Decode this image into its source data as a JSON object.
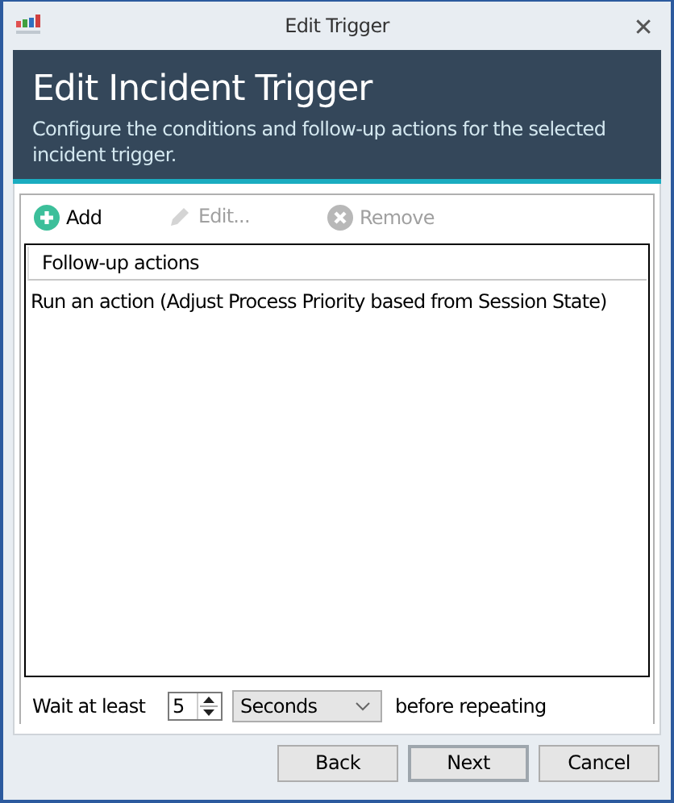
{
  "window": {
    "title": "Edit Trigger",
    "close": "✕"
  },
  "header": {
    "title": "Edit Incident Trigger",
    "subtitle": "Configure the conditions and follow-up actions for the selected incident trigger."
  },
  "toolbar": [
    {
      "kind": "add",
      "label": "Add",
      "disabled": false
    },
    {
      "kind": "edit",
      "label": "Edit...",
      "disabled": true
    },
    {
      "kind": "remove",
      "label": "Remove",
      "disabled": true
    }
  ],
  "list": {
    "columns": [
      "Follow-up actions"
    ],
    "rows": [
      "Run an action (Adjust Process Priority based from Session State)"
    ]
  },
  "wait": {
    "label": "Wait at least",
    "value": "5",
    "unit": "Seconds",
    "suffix": "before repeating"
  },
  "buttons": [
    {
      "label": "Back",
      "default": false
    },
    {
      "label": "Next",
      "default": true
    },
    {
      "label": "Cancel",
      "default": false
    }
  ]
}
